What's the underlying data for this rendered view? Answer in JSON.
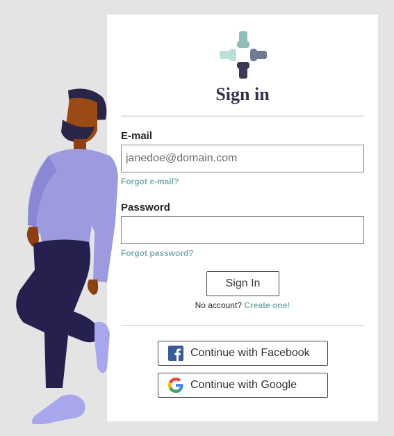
{
  "brand": {
    "logo_icon": "hands-circle-icon"
  },
  "signin_card": {
    "title": "Sign in",
    "email": {
      "label": "E-mail",
      "placeholder": "janedoe@domain.com",
      "value": "",
      "forgot_link": "Forgot e-mail?"
    },
    "password": {
      "label": "Password",
      "value": "",
      "forgot_link": "Forgot password?"
    },
    "signin_button": "Sign In",
    "no_account_text": "No account?",
    "create_link": "Create one!",
    "social": [
      {
        "label": "Continue with Facebook",
        "icon": "facebook-icon"
      },
      {
        "label": "Continue with Google",
        "icon": "google-icon"
      }
    ]
  },
  "colors": {
    "title": "#33314b",
    "link": "#7ab0ad",
    "background": "#e4e4e4",
    "card": "#ffffff",
    "facebook": "#3b5998"
  },
  "illustration": {
    "icon": "person-leaning-illustration"
  }
}
